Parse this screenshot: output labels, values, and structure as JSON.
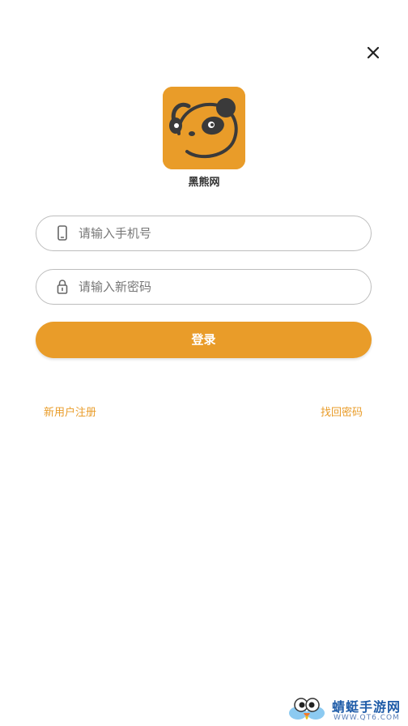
{
  "app": {
    "name": "黑熊网",
    "brand_color": "#e99c29"
  },
  "header": {
    "close_icon": "close-icon"
  },
  "form": {
    "phone": {
      "icon": "phone-icon",
      "placeholder": "请输入手机号",
      "value": ""
    },
    "password": {
      "icon": "lock-icon",
      "placeholder": "请输入新密码",
      "value": ""
    },
    "login_label": "登录"
  },
  "links": {
    "register": "新用户注册",
    "forgot_password": "找回密码"
  },
  "watermark": {
    "title": "蜻蜓手游网",
    "url": "WWW.QT6.COM"
  }
}
